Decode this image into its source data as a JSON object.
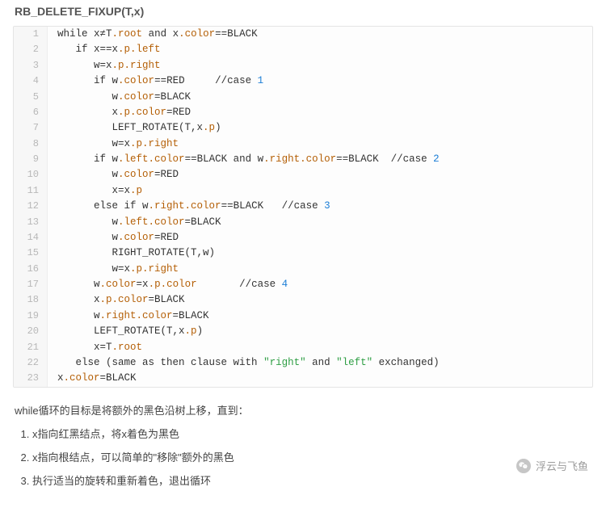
{
  "title": "RB_DELETE_FIXUP(T,x)",
  "code": {
    "lines": [
      {
        "n": 1,
        "i": 0,
        "t": [
          [
            "kw",
            "while"
          ],
          [
            "txt",
            " x≠T"
          ],
          [
            "prop",
            ".root"
          ],
          [
            "txt",
            " "
          ],
          [
            "kw",
            "and"
          ],
          [
            "txt",
            " x"
          ],
          [
            "prop",
            ".color"
          ],
          [
            "txt",
            "==BLACK"
          ]
        ]
      },
      {
        "n": 2,
        "i": 1,
        "t": [
          [
            "kw",
            "if"
          ],
          [
            "txt",
            " x==x"
          ],
          [
            "prop",
            ".p.left"
          ]
        ]
      },
      {
        "n": 3,
        "i": 2,
        "t": [
          [
            "txt",
            "w=x"
          ],
          [
            "prop",
            ".p.right"
          ]
        ]
      },
      {
        "n": 4,
        "i": 2,
        "t": [
          [
            "kw",
            "if"
          ],
          [
            "txt",
            " w"
          ],
          [
            "prop",
            ".color"
          ],
          [
            "txt",
            "==RED     //case "
          ],
          [
            "num",
            "1"
          ]
        ]
      },
      {
        "n": 5,
        "i": 3,
        "t": [
          [
            "txt",
            "w"
          ],
          [
            "prop",
            ".color"
          ],
          [
            "txt",
            "=BLACK"
          ]
        ]
      },
      {
        "n": 6,
        "i": 3,
        "t": [
          [
            "txt",
            "x"
          ],
          [
            "prop",
            ".p.color"
          ],
          [
            "txt",
            "=RED"
          ]
        ]
      },
      {
        "n": 7,
        "i": 3,
        "t": [
          [
            "txt",
            "LEFT_ROTATE(T,x"
          ],
          [
            "prop",
            ".p"
          ],
          [
            "txt",
            ")"
          ]
        ]
      },
      {
        "n": 8,
        "i": 3,
        "t": [
          [
            "txt",
            "w=x"
          ],
          [
            "prop",
            ".p.right"
          ]
        ]
      },
      {
        "n": 9,
        "i": 2,
        "t": [
          [
            "kw",
            "if"
          ],
          [
            "txt",
            " w"
          ],
          [
            "prop",
            ".left.color"
          ],
          [
            "txt",
            "==BLACK "
          ],
          [
            "kw",
            "and"
          ],
          [
            "txt",
            " w"
          ],
          [
            "prop",
            ".right.color"
          ],
          [
            "txt",
            "==BLACK  //case "
          ],
          [
            "num",
            "2"
          ]
        ]
      },
      {
        "n": 10,
        "i": 3,
        "t": [
          [
            "txt",
            "w"
          ],
          [
            "prop",
            ".color"
          ],
          [
            "txt",
            "=RED"
          ]
        ]
      },
      {
        "n": 11,
        "i": 3,
        "t": [
          [
            "txt",
            "x=x"
          ],
          [
            "prop",
            ".p"
          ]
        ]
      },
      {
        "n": 12,
        "i": 2,
        "t": [
          [
            "kw",
            "else if"
          ],
          [
            "txt",
            " w"
          ],
          [
            "prop",
            ".right.color"
          ],
          [
            "txt",
            "==BLACK   //case "
          ],
          [
            "num",
            "3"
          ]
        ]
      },
      {
        "n": 13,
        "i": 3,
        "t": [
          [
            "txt",
            "w"
          ],
          [
            "prop",
            ".left.color"
          ],
          [
            "txt",
            "=BLACK"
          ]
        ]
      },
      {
        "n": 14,
        "i": 3,
        "t": [
          [
            "txt",
            "w"
          ],
          [
            "prop",
            ".color"
          ],
          [
            "txt",
            "=RED"
          ]
        ]
      },
      {
        "n": 15,
        "i": 3,
        "t": [
          [
            "txt",
            "RIGHT_ROTATE(T,w)"
          ]
        ]
      },
      {
        "n": 16,
        "i": 3,
        "t": [
          [
            "txt",
            "w=x"
          ],
          [
            "prop",
            ".p.right"
          ]
        ]
      },
      {
        "n": 17,
        "i": 2,
        "t": [
          [
            "txt",
            "w"
          ],
          [
            "prop",
            ".color"
          ],
          [
            "txt",
            "=x"
          ],
          [
            "prop",
            ".p.color"
          ],
          [
            "txt",
            "       //case "
          ],
          [
            "num",
            "4"
          ]
        ]
      },
      {
        "n": 18,
        "i": 2,
        "t": [
          [
            "txt",
            "x"
          ],
          [
            "prop",
            ".p.color"
          ],
          [
            "txt",
            "=BLACK"
          ]
        ]
      },
      {
        "n": 19,
        "i": 2,
        "t": [
          [
            "txt",
            "w"
          ],
          [
            "prop",
            ".right.color"
          ],
          [
            "txt",
            "=BLACK"
          ]
        ]
      },
      {
        "n": 20,
        "i": 2,
        "t": [
          [
            "txt",
            "LEFT_ROTATE(T,x"
          ],
          [
            "prop",
            ".p"
          ],
          [
            "txt",
            ")"
          ]
        ]
      },
      {
        "n": 21,
        "i": 2,
        "t": [
          [
            "txt",
            "x=T"
          ],
          [
            "prop",
            ".root"
          ]
        ]
      },
      {
        "n": 22,
        "i": 1,
        "t": [
          [
            "kw",
            "else"
          ],
          [
            "txt",
            " (same as then clause with "
          ],
          [
            "str",
            "\"right\""
          ],
          [
            "txt",
            " and "
          ],
          [
            "str",
            "\"left\""
          ],
          [
            "txt",
            " exchanged)"
          ]
        ]
      },
      {
        "n": 23,
        "i": 0,
        "t": [
          [
            "txt",
            "x"
          ],
          [
            "prop",
            ".color"
          ],
          [
            "txt",
            "=BLACK"
          ]
        ]
      }
    ],
    "indent_unit": "   "
  },
  "paragraph": "while循环的目标是将额外的黑色沿树上移，直到：",
  "steps": [
    "x指向红黑结点，将x着色为黑色",
    "x指向根结点，可以简单的\"移除\"额外的黑色",
    "执行适当的旋转和重新着色，退出循环"
  ],
  "watermark": {
    "text": "浮云与飞鱼",
    "icon": "wechat-icon"
  }
}
